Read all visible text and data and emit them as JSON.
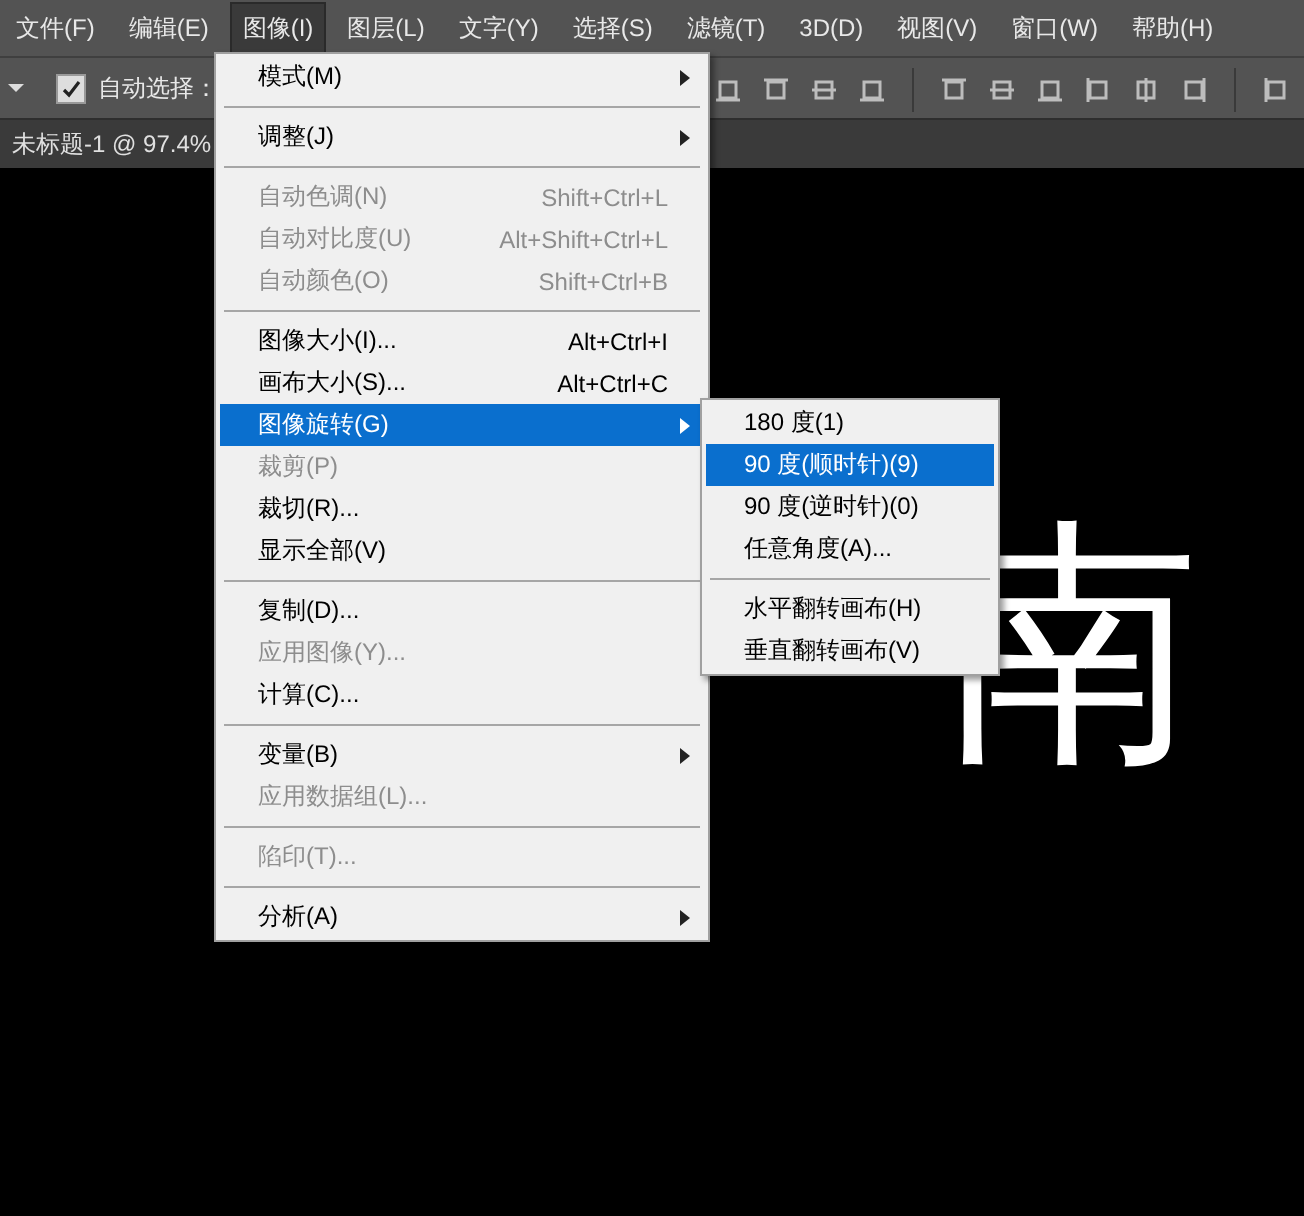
{
  "menu_bar": [
    {
      "label": "文件(F)",
      "selected": false
    },
    {
      "label": "编辑(E)",
      "selected": false
    },
    {
      "label": "图像(I)",
      "selected": true
    },
    {
      "label": "图层(L)",
      "selected": false
    },
    {
      "label": "文字(Y)",
      "selected": false
    },
    {
      "label": "选择(S)",
      "selected": false
    },
    {
      "label": "滤镜(T)",
      "selected": false
    },
    {
      "label": "3D(D)",
      "selected": false
    },
    {
      "label": "视图(V)",
      "selected": false
    },
    {
      "label": "窗口(W)",
      "selected": false
    },
    {
      "label": "帮助(H)",
      "selected": false
    }
  ],
  "options_bar": {
    "auto_select": {
      "label": "自动选择：",
      "checked": true
    }
  },
  "document_tab": {
    "title": "未标题-1 @ 97.4%"
  },
  "canvas": {
    "text": "南"
  },
  "image_menu": [
    {
      "kind": "item",
      "label": "模式(M)",
      "submenu": true,
      "disabled": false,
      "selected": false
    },
    {
      "kind": "separator"
    },
    {
      "kind": "item",
      "label": "调整(J)",
      "submenu": true,
      "disabled": false,
      "selected": false
    },
    {
      "kind": "separator"
    },
    {
      "kind": "item",
      "label": "自动色调(N)",
      "shortcut": "Shift+Ctrl+L",
      "submenu": false,
      "disabled": true,
      "selected": false
    },
    {
      "kind": "item",
      "label": "自动对比度(U)",
      "shortcut": "Alt+Shift+Ctrl+L",
      "submenu": false,
      "disabled": true,
      "selected": false
    },
    {
      "kind": "item",
      "label": "自动颜色(O)",
      "shortcut": "Shift+Ctrl+B",
      "submenu": false,
      "disabled": true,
      "selected": false
    },
    {
      "kind": "separator"
    },
    {
      "kind": "item",
      "label": "图像大小(I)...",
      "shortcut": "Alt+Ctrl+I",
      "submenu": false,
      "disabled": false,
      "selected": false
    },
    {
      "kind": "item",
      "label": "画布大小(S)...",
      "shortcut": "Alt+Ctrl+C",
      "submenu": false,
      "disabled": false,
      "selected": false
    },
    {
      "kind": "item",
      "label": "图像旋转(G)",
      "submenu": true,
      "disabled": false,
      "selected": true
    },
    {
      "kind": "item",
      "label": "裁剪(P)",
      "submenu": false,
      "disabled": true,
      "selected": false
    },
    {
      "kind": "item",
      "label": "裁切(R)...",
      "submenu": false,
      "disabled": false,
      "selected": false
    },
    {
      "kind": "item",
      "label": "显示全部(V)",
      "submenu": false,
      "disabled": false,
      "selected": false
    },
    {
      "kind": "separator"
    },
    {
      "kind": "item",
      "label": "复制(D)...",
      "submenu": false,
      "disabled": false,
      "selected": false
    },
    {
      "kind": "item",
      "label": "应用图像(Y)...",
      "submenu": false,
      "disabled": true,
      "selected": false
    },
    {
      "kind": "item",
      "label": "计算(C)...",
      "submenu": false,
      "disabled": false,
      "selected": false
    },
    {
      "kind": "separator"
    },
    {
      "kind": "item",
      "label": "变量(B)",
      "submenu": true,
      "disabled": false,
      "selected": false
    },
    {
      "kind": "item",
      "label": "应用数据组(L)...",
      "submenu": false,
      "disabled": true,
      "selected": false
    },
    {
      "kind": "separator"
    },
    {
      "kind": "item",
      "label": "陷印(T)...",
      "submenu": false,
      "disabled": true,
      "selected": false
    },
    {
      "kind": "separator"
    },
    {
      "kind": "item",
      "label": "分析(A)",
      "submenu": true,
      "disabled": false,
      "selected": false
    }
  ],
  "rotate_submenu": [
    {
      "kind": "item",
      "label": "180 度(1)",
      "selected": false
    },
    {
      "kind": "item",
      "label": "90 度(顺时针)(9)",
      "selected": true
    },
    {
      "kind": "item",
      "label": "90 度(逆时针)(0)",
      "selected": false
    },
    {
      "kind": "item",
      "label": "任意角度(A)...",
      "selected": false
    },
    {
      "kind": "separator"
    },
    {
      "kind": "item",
      "label": "水平翻转画布(H)",
      "selected": false
    },
    {
      "kind": "item",
      "label": "垂直翻转画布(V)",
      "selected": false
    }
  ]
}
